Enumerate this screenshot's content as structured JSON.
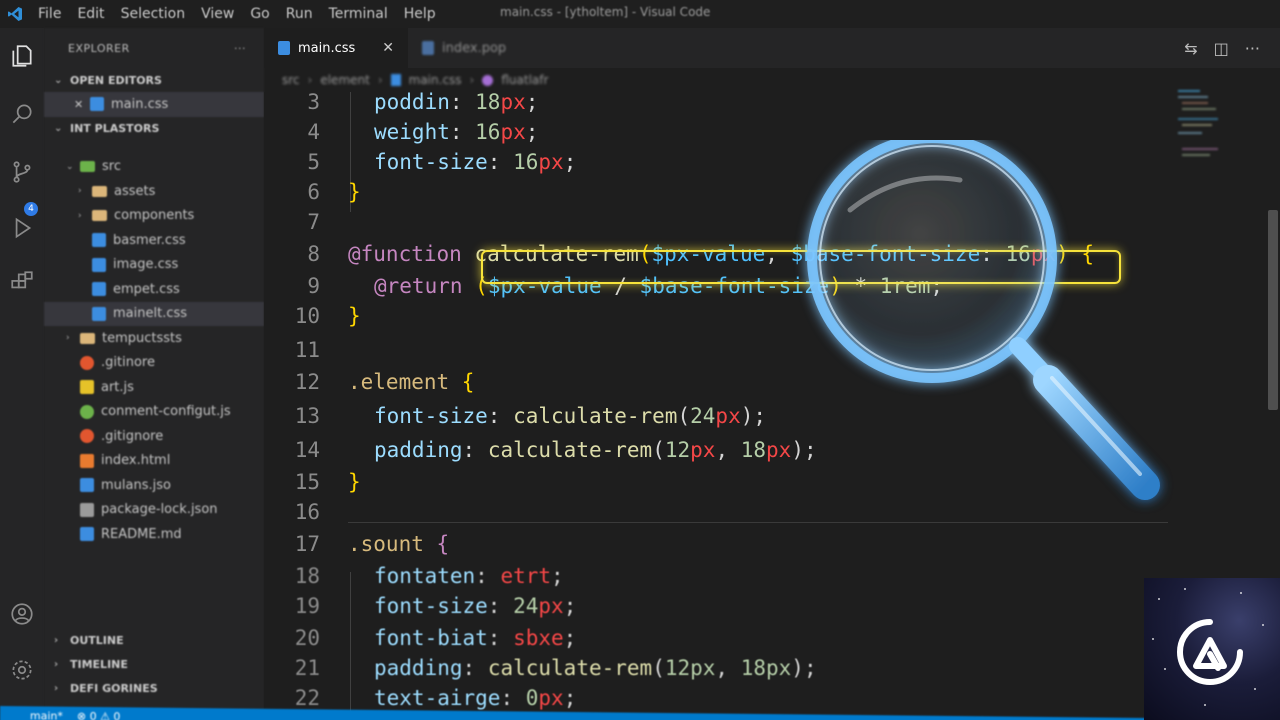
{
  "window": {
    "title": "main.css - [ytholtem] - Visual Code",
    "menu": [
      "File",
      "Edit",
      "Selection",
      "View",
      "Go",
      "Run",
      "Terminal",
      "Help"
    ]
  },
  "sidebar": {
    "header": "EXPLORER",
    "more": "···",
    "open_editors_label": "OPEN EDITORS",
    "open_editor_file": "main.css",
    "project_label": "INT PLASTORS",
    "tree": [
      {
        "label": "src",
        "kind": "folder",
        "depth": 1
      },
      {
        "label": "assets",
        "kind": "folder",
        "depth": 2
      },
      {
        "label": "components",
        "kind": "folder",
        "depth": 2
      },
      {
        "label": "basmer.css",
        "kind": "css",
        "depth": 2
      },
      {
        "label": "image.css",
        "kind": "css",
        "depth": 2
      },
      {
        "label": "empet.css",
        "kind": "css",
        "depth": 2
      },
      {
        "label": "mainelt.css",
        "kind": "css",
        "depth": 2,
        "selected": true
      },
      {
        "label": "tempuctssts",
        "kind": "folder",
        "depth": 1
      },
      {
        "label": ".gitinore",
        "kind": "git",
        "depth": 1
      },
      {
        "label": "art.js",
        "kind": "js",
        "depth": 1
      },
      {
        "label": "conment-configut.js",
        "kind": "config",
        "depth": 1
      },
      {
        "label": ".gitignore",
        "kind": "git",
        "depth": 1
      },
      {
        "label": "index.html",
        "kind": "html",
        "depth": 1
      },
      {
        "label": "mulans.jso",
        "kind": "json",
        "depth": 1
      },
      {
        "label": "package-lock.json",
        "kind": "jsonb",
        "depth": 1
      },
      {
        "label": "README.md",
        "kind": "md",
        "depth": 1
      }
    ],
    "bottom_sections": [
      "OUTLINE",
      "TIMELINE",
      "DEFI GORINES"
    ]
  },
  "activity_bar": {
    "badge": "4",
    "icons": [
      "explorer-icon",
      "search-icon",
      "source-control-icon",
      "run-debug-icon",
      "extensions-icon",
      "account-icon",
      "settings-gear-icon"
    ]
  },
  "tabs": [
    {
      "label": "main.css",
      "active": true,
      "close": "✕"
    },
    {
      "label": "index.pop",
      "active": false
    }
  ],
  "breadcrumb": [
    "src",
    "element",
    "main.css",
    "fluatlafr"
  ],
  "editor": {
    "lines": [
      {
        "n": "3",
        "seg": [
          [
            "poddin",
            "prop"
          ],
          [
            ": ",
            "punc"
          ],
          [
            "18",
            "num"
          ],
          [
            "px",
            "unit"
          ],
          [
            ";",
            "punc"
          ]
        ],
        "indent": 1
      },
      {
        "n": "4",
        "seg": [
          [
            "weight",
            "prop"
          ],
          [
            ": ",
            "punc"
          ],
          [
            "16",
            "num"
          ],
          [
            "px",
            "unit"
          ],
          [
            ";",
            "punc"
          ]
        ],
        "indent": 1
      },
      {
        "n": "5",
        "seg": [
          [
            "font-size",
            "prop"
          ],
          [
            ": ",
            "punc"
          ],
          [
            "16",
            "num"
          ],
          [
            "px",
            "unit"
          ],
          [
            ";",
            "punc"
          ]
        ],
        "indent": 1
      },
      {
        "n": "6",
        "seg": [
          [
            "}",
            "brace"
          ]
        ],
        "indent": 0
      },
      {
        "n": "7",
        "seg": [],
        "indent": 0
      },
      {
        "n": "8",
        "seg": [
          [
            "@function ",
            "kw"
          ],
          [
            "calculate-rem",
            "fn"
          ],
          [
            "(",
            "brace"
          ],
          [
            "$px-value",
            "var"
          ],
          [
            ", ",
            "punc"
          ],
          [
            "$base-font-size",
            "var"
          ],
          [
            ": ",
            "punc"
          ],
          [
            "16",
            "num"
          ],
          [
            "px",
            "unit"
          ],
          [
            ")",
            "brace"
          ],
          [
            " {",
            "brace"
          ]
        ],
        "indent": 0
      },
      {
        "n": "9",
        "seg": [
          [
            "@return ",
            "kw"
          ],
          [
            "(",
            "brace"
          ],
          [
            "$px-value",
            "var"
          ],
          [
            " / ",
            "punc"
          ],
          [
            "$base-font-size",
            "var"
          ],
          [
            ")",
            "brace"
          ],
          [
            " * ",
            "punc"
          ],
          [
            "1",
            "num"
          ],
          [
            "rem",
            "num"
          ],
          [
            ";",
            "punc"
          ]
        ],
        "indent": 1
      },
      {
        "n": "10",
        "seg": [
          [
            "}",
            "brace"
          ]
        ],
        "indent": 0
      },
      {
        "n": "11",
        "seg": [],
        "indent": 0
      },
      {
        "n": "12",
        "seg": [
          [
            ".element ",
            "sel"
          ],
          [
            "{",
            "brace"
          ]
        ],
        "indent": 0
      },
      {
        "n": "13",
        "seg": [
          [
            "font-size",
            "prop"
          ],
          [
            ": ",
            "punc"
          ],
          [
            "calculate-rem",
            "fn"
          ],
          [
            "(",
            "punc"
          ],
          [
            "24",
            "num"
          ],
          [
            "px",
            "unit"
          ],
          [
            ");",
            "punc"
          ]
        ],
        "indent": 1
      },
      {
        "n": "14",
        "seg": [
          [
            "padding",
            "prop"
          ],
          [
            ": ",
            "punc"
          ],
          [
            "calculate-rem",
            "fn"
          ],
          [
            "(",
            "punc"
          ],
          [
            "12",
            "num"
          ],
          [
            "px",
            "unit"
          ],
          [
            ", ",
            "punc"
          ],
          [
            "18",
            "num"
          ],
          [
            "px",
            "unit"
          ],
          [
            ");",
            "punc"
          ]
        ],
        "indent": 1
      },
      {
        "n": "15",
        "seg": [
          [
            "}",
            "brace"
          ]
        ],
        "indent": 0
      },
      {
        "n": "16",
        "seg": [],
        "indent": 0
      },
      {
        "n": "17",
        "seg": [
          [
            ".sount ",
            "sel"
          ],
          [
            "{",
            "kw"
          ]
        ],
        "indent": 0
      },
      {
        "n": "18",
        "seg": [
          [
            "fontaten",
            "prop"
          ],
          [
            ": ",
            "punc"
          ],
          [
            "etrt",
            "unit"
          ],
          [
            ";",
            "punc"
          ]
        ],
        "indent": 1
      },
      {
        "n": "19",
        "seg": [
          [
            "font-size",
            "prop"
          ],
          [
            ": ",
            "punc"
          ],
          [
            "24",
            "num"
          ],
          [
            "px",
            "unit"
          ],
          [
            ";",
            "punc"
          ]
        ],
        "indent": 1
      },
      {
        "n": "20",
        "seg": [
          [
            "font-biat",
            "prop"
          ],
          [
            ": ",
            "punc"
          ],
          [
            "sbxe",
            "unit"
          ],
          [
            ";",
            "punc"
          ]
        ],
        "indent": 1
      },
      {
        "n": "21",
        "seg": [
          [
            "padding",
            "prop"
          ],
          [
            ": ",
            "punc"
          ],
          [
            "calculate-rem",
            "fn"
          ],
          [
            "(",
            "punc"
          ],
          [
            "12px",
            "num"
          ],
          [
            ", ",
            "punc"
          ],
          [
            "18px",
            "num"
          ],
          [
            ");",
            "punc"
          ]
        ],
        "indent": 1
      },
      {
        "n": "22",
        "seg": [
          [
            "text-airge",
            "prop"
          ],
          [
            ": ",
            "punc"
          ],
          [
            "0",
            "num"
          ],
          [
            "px",
            "unit"
          ],
          [
            ";",
            "punc"
          ]
        ],
        "indent": 1
      }
    ]
  },
  "statusbar": [
    "main*",
    "⊗ 0 ⚠ 0"
  ],
  "colors": {
    "editor_bg": "#1e1e1e",
    "sidebar_bg": "#252526",
    "highlight": "#f7e33b",
    "status_bar": "#007acc",
    "magnifier_glow": "#5ab8ff"
  }
}
